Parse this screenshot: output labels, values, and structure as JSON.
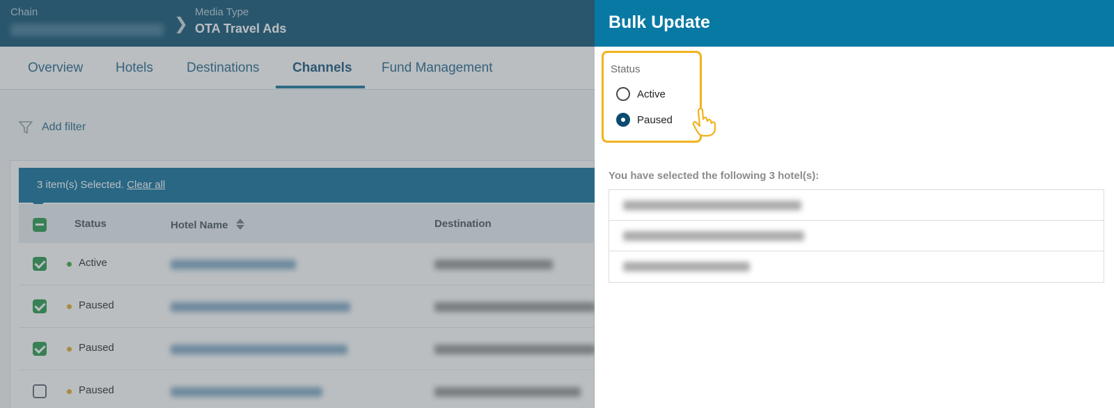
{
  "header": {
    "chain_label": "Chain",
    "media_type_label": "Media Type",
    "media_type_value": "OTA Travel Ads"
  },
  "tabs": [
    {
      "label": "Overview",
      "active": false
    },
    {
      "label": "Hotels",
      "active": false
    },
    {
      "label": "Destinations",
      "active": false
    },
    {
      "label": "Channels",
      "active": true
    },
    {
      "label": "Fund Management",
      "active": false
    }
  ],
  "filter": {
    "label": "Add filter"
  },
  "selection": {
    "text": "3 item(s) Selected.",
    "clear_label": "Clear all"
  },
  "table": {
    "columns": [
      "Status",
      "Hotel Name",
      "Destination"
    ],
    "rows": [
      {
        "checked": true,
        "status": "Active",
        "status_color": "#37a73a"
      },
      {
        "checked": true,
        "status": "Paused",
        "status_color": "#e3a51d"
      },
      {
        "checked": true,
        "status": "Paused",
        "status_color": "#e3a51d"
      },
      {
        "checked": false,
        "status": "Paused",
        "status_color": "#e3a51d"
      }
    ]
  },
  "panel": {
    "title": "Bulk Update",
    "status_label": "Status",
    "options": [
      {
        "label": "Active",
        "selected": false
      },
      {
        "label": "Paused",
        "selected": true
      }
    ],
    "selected_title": "You have selected the following 3 hotel(s):"
  },
  "colors": {
    "topbar": "#064c6e",
    "panel_header": "#0879a3",
    "highlight": "#f1b21d",
    "checkbox": "#1f9446"
  }
}
